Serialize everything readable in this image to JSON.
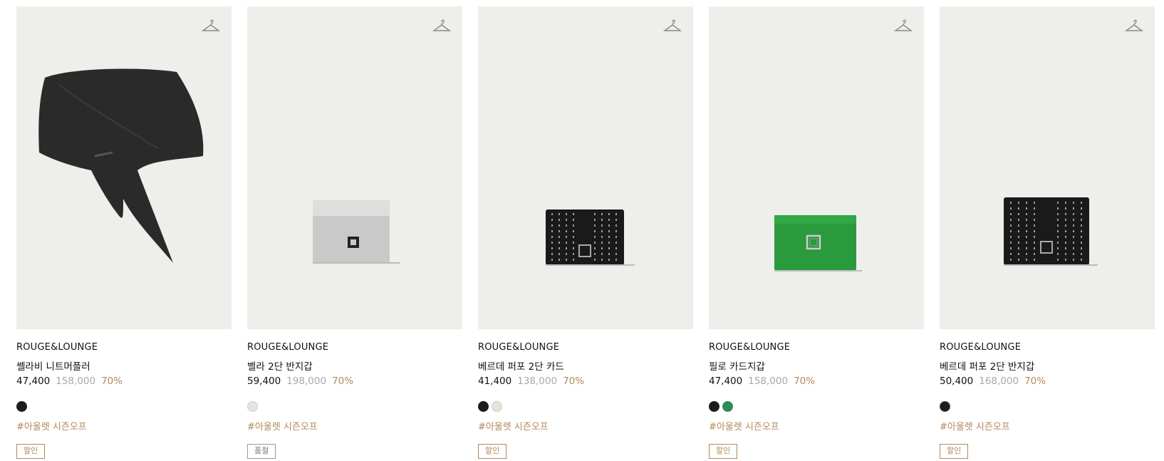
{
  "products": [
    {
      "brand": "ROUGE&LOUNGE",
      "name": "쎌라비 니트머플러",
      "price": "47,400",
      "original_price": "158,000",
      "discount": "70%",
      "tag": "#아울렛 시즌오프",
      "badge": "할인",
      "swatches": [
        "#1c1c1c"
      ]
    },
    {
      "brand": "ROUGE&LOUNGE",
      "name": "벨라 2단 반지갑",
      "price": "59,400",
      "original_price": "198,000",
      "discount": "70%",
      "tag": "#아울렛 시즌오프",
      "badge": "품절",
      "swatches": [
        "#d8d8d8"
      ]
    },
    {
      "brand": "ROUGE&LOUNGE",
      "name": "베르데 퍼포 2단 카드",
      "price": "41,400",
      "original_price": "138,000",
      "discount": "70%",
      "tag": "#아울렛 시즌오프",
      "badge": "할인",
      "swatches": [
        "#1c1c1c",
        "#e6e4d6"
      ]
    },
    {
      "brand": "ROUGE&LOUNGE",
      "name": "필로 카드지갑",
      "price": "47,400",
      "original_price": "158,000",
      "discount": "70%",
      "tag": "#아울렛 시즌오프",
      "badge": "할인",
      "swatches": [
        "#1c1c1c",
        "#2e8b57"
      ]
    },
    {
      "brand": "ROUGE&LOUNGE",
      "name": "베르데 퍼포 2단 반지갑",
      "price": "50,400",
      "original_price": "168,000",
      "discount": "70%",
      "tag": "#아울렛 시즌오프",
      "badge": "할인",
      "swatches": [
        "#1c1c1c"
      ]
    }
  ],
  "colors": {
    "accent": "#b0895a",
    "thumb_bg": "#eeeeea",
    "muted": "#a8a8a8"
  }
}
